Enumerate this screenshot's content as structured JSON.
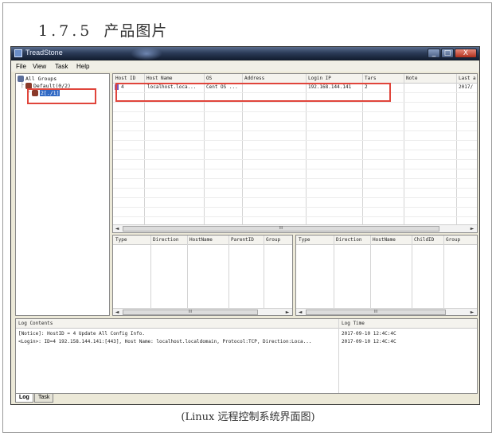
{
  "doc": {
    "section_number": "1.7.5",
    "section_title": "产品图片",
    "caption": "(Linux 远程控制系统界面图)"
  },
  "window": {
    "title": "TreadStone",
    "min_symbol": "_",
    "max_symbol": "□",
    "close_symbol": "X"
  },
  "menu": [
    "File",
    "View",
    "Task",
    "Help"
  ],
  "tree": {
    "root": "All Groups",
    "group": "Default(0/2)",
    "host": "2[./1]"
  },
  "hosts": {
    "columns": [
      "Host ID",
      "Host Name",
      "OS",
      "Address",
      "Login IP",
      "Tars",
      "Note",
      "Last a"
    ],
    "rows": [
      [
        "4",
        "localhost.loca...",
        "Cent OS ...",
        "",
        "192.168.144.141",
        "2",
        "",
        "2017/"
      ]
    ]
  },
  "tasks_left": {
    "columns": [
      "Type",
      "Direction",
      "HostName",
      "ParentID",
      "Group"
    ]
  },
  "tasks_right": {
    "columns": [
      "Type",
      "Direction",
      "HostName",
      "ChildID",
      "Group"
    ]
  },
  "log": {
    "columns": [
      "Log Contents",
      "Log Time"
    ],
    "rows": [
      [
        "[Notice]: HostID = 4 Update All Config Info.",
        "2017-09-10 12:4C:4C"
      ],
      [
        "<Login>: ID=4 192.158.144.141:[443], Host Name: localhost.localdomain, Protocol:TCP, Direction:Loca...",
        "2017-09-10 12:4C:4C"
      ]
    ]
  },
  "tabs": [
    "Log",
    "Task"
  ],
  "scroll_glyph": "III",
  "arrows": {
    "left": "◄",
    "right": "►"
  },
  "colors": {
    "highlight": "#e0453b",
    "selection": "#316ac5"
  }
}
